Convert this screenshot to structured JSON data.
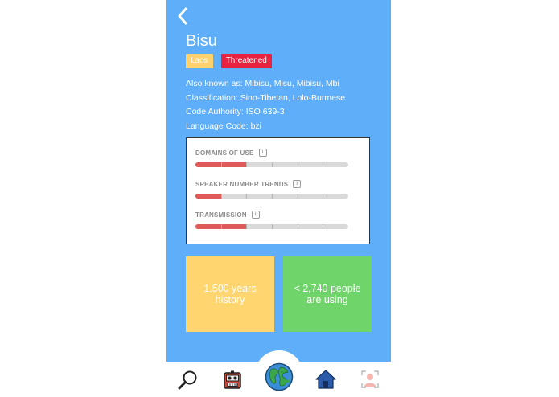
{
  "language": {
    "name": "Bisu",
    "region": "Laos",
    "status": "Threatened",
    "details": {
      "also_known_as": "Also known as: Mibisu, Misu, Mibisu, Mbi",
      "classification": "Classification: Sino-Tibetan, Lolo-Burmese",
      "code_authority": "Code Authority: ISO 639-3",
      "language_code": "Language Code: bzi"
    }
  },
  "metrics": [
    {
      "label": "DOMAINS OF USE",
      "info_icon": "info-icon",
      "level": 2,
      "max": 6
    },
    {
      "label": "SPEAKER NUMBER TRENDS",
      "info_icon": "info-icon",
      "level": 1,
      "max": 6
    },
    {
      "label": "TRANSMISSION",
      "info_icon": "info-icon",
      "level": 2,
      "max": 6
    }
  ],
  "cards": {
    "history": "1,500 years history",
    "speakers": "< 2,740 people are using"
  },
  "colors": {
    "background": "#5eaef9",
    "badge_region": "#ffd26f",
    "badge_status": "#e9223f",
    "bar_fill": "#e05a5a",
    "card_history": "#ffd56f",
    "card_speakers": "#6fd56a"
  },
  "nav": {
    "items": [
      {
        "icon": "search-icon"
      },
      {
        "icon": "robot-icon"
      },
      {
        "icon": "globe-icon"
      },
      {
        "icon": "home-icon"
      },
      {
        "icon": "profile-icon"
      }
    ]
  }
}
